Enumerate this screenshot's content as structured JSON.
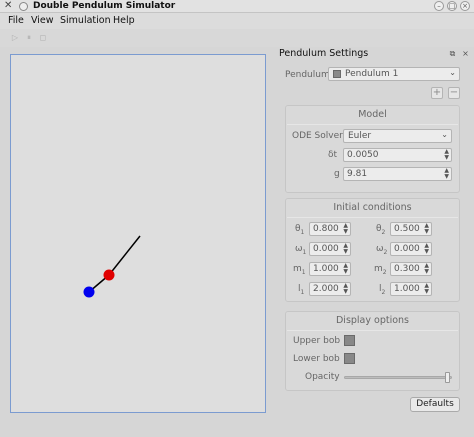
{
  "window": {
    "title": "Double Pendulum Simulator"
  },
  "menu": [
    "File",
    "View",
    "Simulation",
    "Help"
  ],
  "toolbar": {
    "play_icon": "▷",
    "pause_icon": "⏸",
    "stop_icon": "◻"
  },
  "dock": {
    "title": "Pendulum Settings"
  },
  "pendulum": {
    "label": "Pendulum",
    "selected": "Pendulum 1"
  },
  "model": {
    "title": "Model",
    "solver_label": "ODE Solver",
    "solver": "Euler",
    "dt_label": "δt",
    "dt": "0.0050",
    "g_label": "g",
    "g": "9.81"
  },
  "initial": {
    "title": "Initial conditions",
    "theta1": "0.800",
    "theta2": "0.500",
    "omega1": "0.000",
    "omega2": "0.000",
    "m1": "1.000",
    "m2": "0.300",
    "l1": "2.000",
    "l2": "1.000"
  },
  "display": {
    "title": "Display options",
    "upper_bob_label": "Upper bob",
    "lower_bob_label": "Lower bob",
    "opacity_label": "Opacity",
    "opacity": 0.98
  },
  "defaults_label": "Defaults",
  "colors": {
    "upper_bob": "#e00000",
    "lower_bob": "#0000ee",
    "rod": "#000000",
    "canvas_border": "#7b9bd0"
  }
}
